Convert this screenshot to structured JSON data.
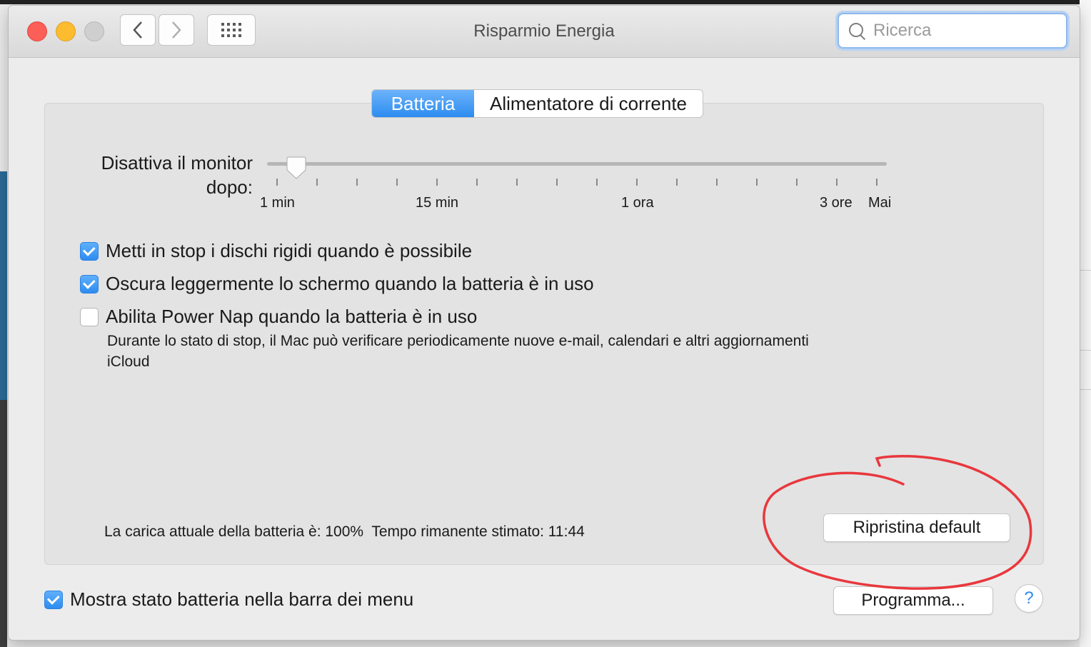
{
  "window": {
    "title": "Risparmio Energia"
  },
  "toolbar": {
    "back_icon": "chevron-left-icon",
    "forward_icon": "chevron-right-icon",
    "grid_icon": "grid-icon"
  },
  "search": {
    "placeholder": "Ricerca",
    "icon": "search-icon"
  },
  "tabs": [
    {
      "label": "Batteria",
      "active": true
    },
    {
      "label": "Alimentatore di corrente",
      "active": false
    }
  ],
  "slider": {
    "label_line1": "Disattiva il monitor",
    "label_line2": "dopo:",
    "value": "1 min",
    "ticks": [
      "1 min",
      "15 min",
      "1 ora",
      "3 ore",
      "Mai"
    ]
  },
  "options": [
    {
      "label": "Metti in stop i dischi rigidi quando è possibile",
      "checked": true
    },
    {
      "label": "Oscura leggermente lo schermo quando la batteria è in uso",
      "checked": true
    },
    {
      "label": "Abilita Power Nap quando la batteria è in uso",
      "checked": false
    }
  ],
  "power_nap_description": "Durante lo stato di stop, il Mac può verificare periodicamente nuove e-mail, calendari e altri aggiornamenti iCloud",
  "status": {
    "charge": "La carica attuale della batteria è: 100%",
    "remaining": "Tempo rimanente stimato: 11:44"
  },
  "buttons": {
    "restore_defaults": "Ripristina default",
    "schedule": "Programma...",
    "help": "?"
  },
  "menu_bar_option": {
    "label": "Mostra stato batteria nella barra dei menu",
    "checked": true
  },
  "colors": {
    "accent": "#2d8cf0",
    "close": "#fc5f57",
    "minimize": "#fdbc2e",
    "annotation": "#e8383d"
  }
}
